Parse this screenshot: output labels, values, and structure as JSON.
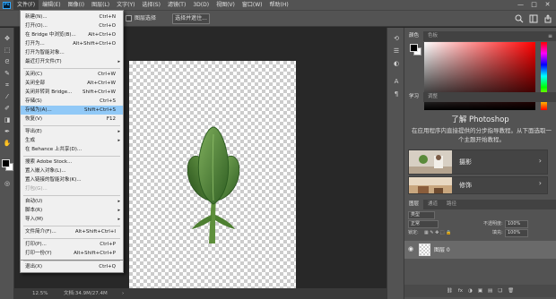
{
  "menubar": {
    "logo": "Ps",
    "items": [
      "文件(F)",
      "编辑(E)",
      "图像(I)",
      "图层(L)",
      "文字(Y)",
      "选择(S)",
      "滤镜(T)",
      "3D(D)",
      "视图(V)",
      "窗口(W)",
      "帮助(H)"
    ],
    "active_index": 0
  },
  "window_controls": [
    "—",
    "□",
    "✕"
  ],
  "options_bar": {
    "checkbox_label": "图层选择",
    "button_label": "选择并遮住..."
  },
  "file_menu": {
    "items": [
      {
        "label": "新建(N)...",
        "shortcut": "Ctrl+N"
      },
      {
        "label": "打开(O)...",
        "shortcut": "Ctrl+O"
      },
      {
        "label": "在 Bridge 中浏览(B)...",
        "shortcut": "Alt+Ctrl+O"
      },
      {
        "label": "打开为...",
        "shortcut": "Alt+Shift+Ctrl+O"
      },
      {
        "label": "打开为智能对象...",
        "shortcut": ""
      },
      {
        "label": "最近打开文件(T)",
        "shortcut": "",
        "submenu": true
      },
      {
        "label": "关闭(C)",
        "shortcut": "Ctrl+W"
      },
      {
        "label": "关闭全部",
        "shortcut": "Alt+Ctrl+W"
      },
      {
        "label": "关闭并转到 Bridge...",
        "shortcut": "Shift+Ctrl+W"
      },
      {
        "label": "存储(S)",
        "shortcut": "Ctrl+S"
      },
      {
        "label": "存储为(A)...",
        "shortcut": "Shift+Ctrl+S",
        "highlight": true
      },
      {
        "label": "恢复(V)",
        "shortcut": "F12"
      },
      {
        "label": "导出(E)",
        "shortcut": "",
        "submenu": true
      },
      {
        "label": "生成",
        "shortcut": "",
        "submenu": true
      },
      {
        "label": "在 Behance 上共享(D)...",
        "shortcut": ""
      },
      {
        "label": "搜索 Adobe Stock...",
        "shortcut": ""
      },
      {
        "label": "置入嵌入对象(L)...",
        "shortcut": ""
      },
      {
        "label": "置入链接的智能对象(K)...",
        "shortcut": ""
      },
      {
        "label": "打包(G)...",
        "shortcut": "",
        "disabled": true
      },
      {
        "label": "自动(U)",
        "shortcut": "",
        "submenu": true
      },
      {
        "label": "脚本(R)",
        "shortcut": "",
        "submenu": true
      },
      {
        "label": "导入(M)",
        "shortcut": "",
        "submenu": true
      },
      {
        "label": "文件简介(F)...",
        "shortcut": "Alt+Shift+Ctrl+I"
      },
      {
        "label": "打印(P)...",
        "shortcut": "Ctrl+P"
      },
      {
        "label": "打印一份(Y)",
        "shortcut": "Alt+Shift+Ctrl+P"
      },
      {
        "label": "退出(X)",
        "shortcut": "Ctrl+Q"
      }
    ],
    "submenu_arrow": "▸"
  },
  "color_panel": {
    "tabs": [
      "颜色",
      "色板"
    ],
    "foreground": "#000000",
    "background": "#ffffff"
  },
  "learn_panel": {
    "tabs": [
      "学习",
      "调整"
    ],
    "title": "了解 Photoshop",
    "description": "在应用程序内直接提供的分步指导教程。从下面选取一个主题开始教程。",
    "cards": [
      {
        "label": "摄影",
        "icon": "photo-thumbnail"
      },
      {
        "label": "修饰",
        "icon": "retouch-thumbnail"
      }
    ],
    "chevron": "›"
  },
  "layers_panel": {
    "tabs": [
      "图层",
      "通道",
      "路径"
    ],
    "filter_kind": "类型",
    "blend_mode": "正常",
    "opacity_label": "不透明度:",
    "opacity_value": "100%",
    "lock_label": "锁定:",
    "fill_label": "填充:",
    "fill_value": "100%",
    "layer_name": "图层 0",
    "footer_icons": [
      "fx",
      "◑",
      "▣",
      "▤",
      "❏",
      "🗑"
    ]
  },
  "status": {
    "zoom": "12.5%",
    "doc_info": "文档:34.9M/27.4M",
    "arrow": "›"
  },
  "accent": "#91c9f7"
}
